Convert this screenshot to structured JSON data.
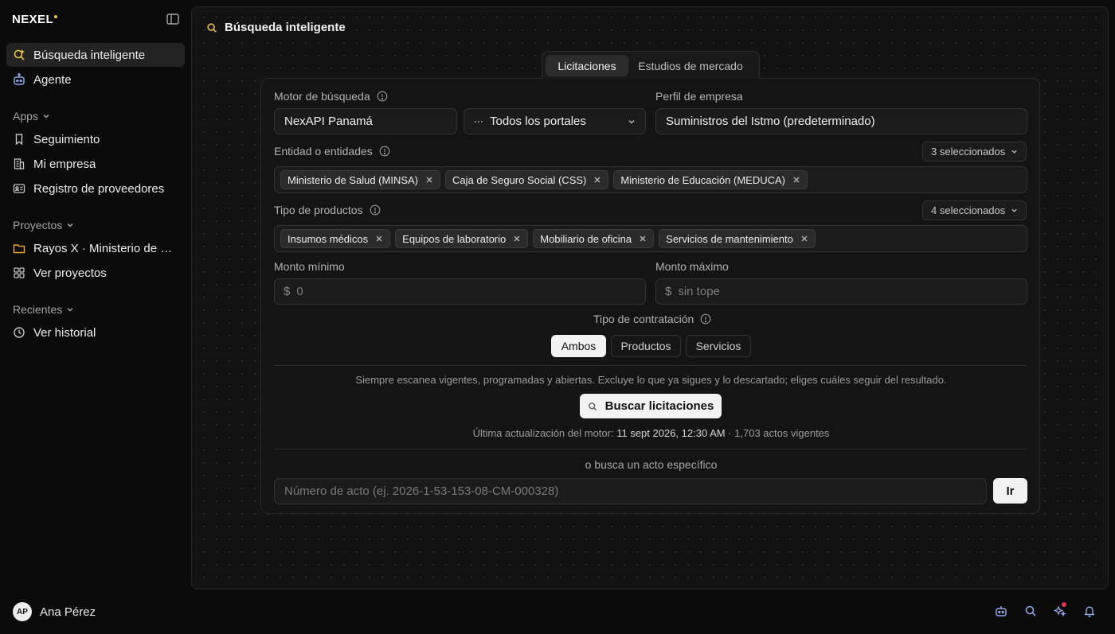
{
  "brand": {
    "name": "NEXEL",
    "accent": "#e8c547"
  },
  "sidebar": {
    "top_items": [
      {
        "label": "Búsqueda inteligente",
        "icon": "smart-search-icon",
        "active": true
      },
      {
        "label": "Agente",
        "icon": "robot-icon",
        "active": false
      }
    ],
    "sections": [
      {
        "title": "Apps",
        "items": [
          {
            "label": "Seguimiento",
            "icon": "bookmark-icon"
          },
          {
            "label": "Mi empresa",
            "icon": "building-icon"
          },
          {
            "label": "Registro de proveedores",
            "icon": "id-card-icon"
          }
        ]
      },
      {
        "title": "Proyectos",
        "items": [
          {
            "label": "Rayos X · Ministerio de S...",
            "icon": "folder-icon"
          },
          {
            "label": "Ver proyectos",
            "icon": "grid-icon"
          }
        ]
      },
      {
        "title": "Recientes",
        "items": [
          {
            "label": "Ver historial",
            "icon": "clock-icon"
          }
        ]
      }
    ],
    "user": {
      "initials": "AP",
      "name": "Ana Pérez"
    }
  },
  "bottom_bar": {
    "icons": [
      "robot-icon",
      "search-icon",
      "sparkles-icon",
      "bell-icon"
    ],
    "notification_color": "#e0364a"
  },
  "main": {
    "title": "Búsqueda inteligente",
    "tabs": [
      {
        "label": "Licitaciones",
        "active": true
      },
      {
        "label": "Estudios de mercado",
        "active": false
      }
    ],
    "form": {
      "engine_label": "Motor de búsqueda",
      "engine_value": "NexAPI Panamá",
      "portal_value": "Todos los portales",
      "profile_label": "Perfil de empresa",
      "profile_value": "Suministros del Istmo (predeterminado)",
      "entities_label": "Entidad o entidades",
      "entities_count": "3 seleccionados",
      "entities": [
        "Ministerio de Salud (MINSA)",
        "Caja de Seguro Social (CSS)",
        "Ministerio de Educación (MEDUCA)"
      ],
      "products_label": "Tipo de productos",
      "products_count": "4 seleccionados",
      "products": [
        "Insumos médicos",
        "Equipos de laboratorio",
        "Mobiliario de oficina",
        "Servicios de mantenimiento"
      ],
      "min_label": "Monto mínimo",
      "min_placeholder": "0",
      "max_label": "Monto máximo",
      "max_placeholder": "sin tope",
      "currency": "$",
      "contract_label": "Tipo de contratación",
      "contract_options": [
        "Ambos",
        "Productos",
        "Servicios"
      ],
      "contract_selected": "Ambos",
      "scan_note": "Siempre escanea vigentes, programadas y abiertas. Excluye lo que ya sigues y lo descartado; eliges cuáles seguir del resultado.",
      "search_button": "Buscar licitaciones",
      "update_prefix": "Última actualización del motor:",
      "update_time": "11 sept 2026, 12:30 AM",
      "update_suffix": "· 1,703 actos vigentes",
      "alt_label": "o busca un acto específico",
      "act_placeholder": "Número de acto (ej. 2026-1-53-153-08-CM-000328)",
      "go_button": "Ir"
    }
  }
}
